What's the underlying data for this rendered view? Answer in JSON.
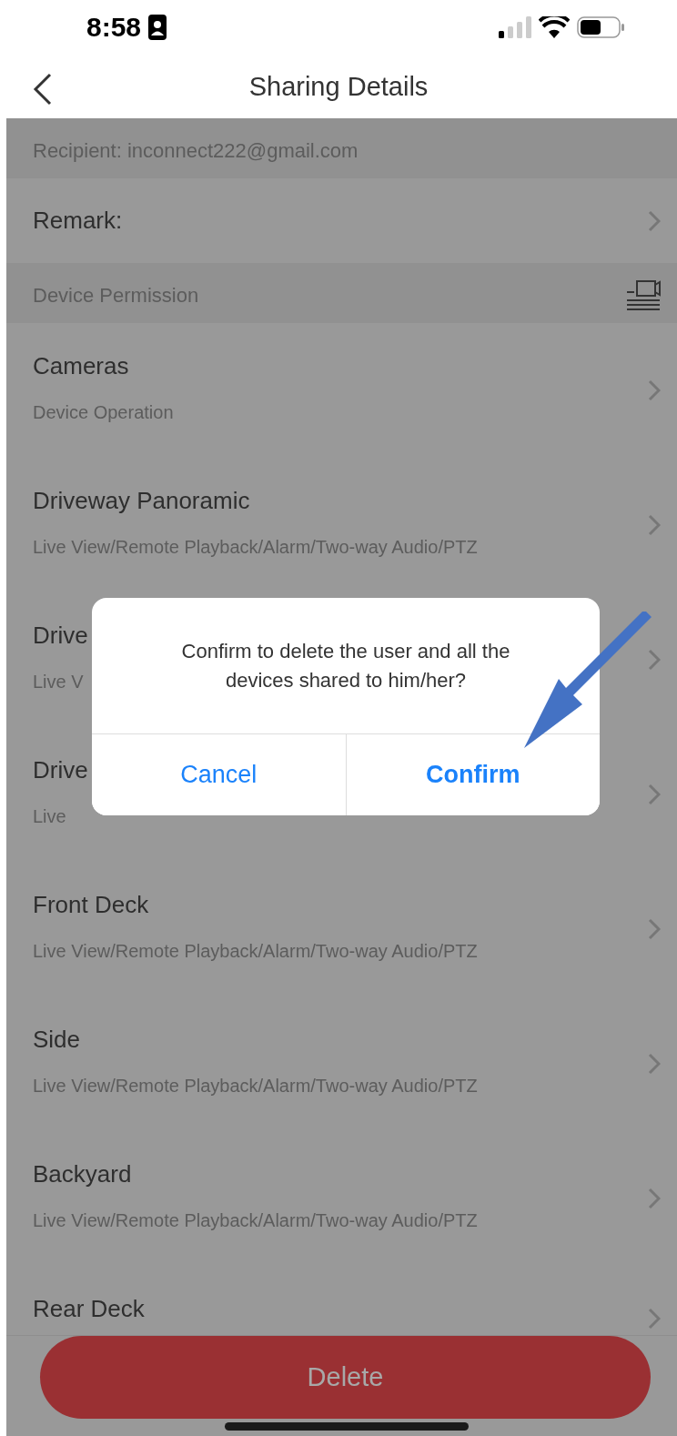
{
  "status_bar": {
    "time": "8:58"
  },
  "nav": {
    "title": "Sharing Details"
  },
  "recipient": "Recipient: inconnect222@gmail.com",
  "remark": {
    "label": "Remark:"
  },
  "section": {
    "title": "Device Permission"
  },
  "devices": [
    {
      "name": "Cameras",
      "permissions": "Device Operation"
    },
    {
      "name": "Driveway Panoramic",
      "permissions": "Live View/Remote Playback/Alarm/Two-way Audio/PTZ"
    },
    {
      "name": "Drive",
      "permissions": "Live V"
    },
    {
      "name": "Drive",
      "permissions": "Live"
    },
    {
      "name": "Front Deck",
      "permissions": "Live View/Remote Playback/Alarm/Two-way Audio/PTZ"
    },
    {
      "name": "Side",
      "permissions": "Live View/Remote Playback/Alarm/Two-way Audio/PTZ"
    },
    {
      "name": "Backyard",
      "permissions": "Live View/Remote Playback/Alarm/Two-way Audio/PTZ"
    },
    {
      "name": "Rear Deck"
    }
  ],
  "dialog": {
    "message": "Confirm to delete the user and all the devices shared to him/her?",
    "buttons": [
      {
        "label": "Cancel",
        "primary": false
      },
      {
        "label": "Confirm",
        "primary": true
      }
    ]
  },
  "delete_button": "Delete"
}
